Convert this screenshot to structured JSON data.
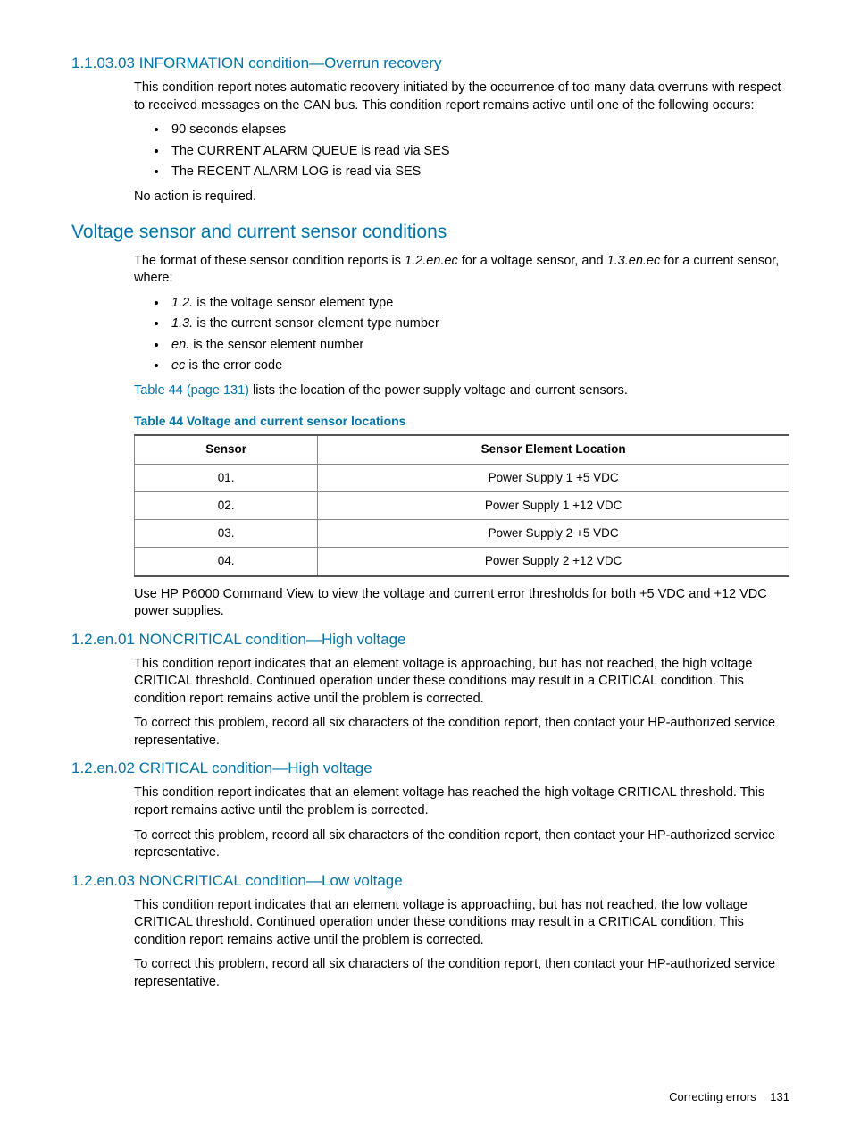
{
  "sec1": {
    "title": "1.1.03.03 INFORMATION condition—Overrun recovery",
    "p1": "This condition report notes automatic recovery initiated by the occurrence of too many data overruns with respect to received messages on the CAN bus. This condition report remains active until one of the following occurs:",
    "b1": "90 seconds elapses",
    "b2": "The CURRENT ALARM QUEUE is read via SES",
    "b3": "The RECENT ALARM LOG is read via SES",
    "p2": "No action is required."
  },
  "sec2": {
    "title": "Voltage sensor and current sensor conditions",
    "p1a": "The format of these sensor condition reports is ",
    "p1b": "1.2.en.ec",
    "p1c": " for a voltage sensor, and ",
    "p1d": "1.3.en.ec",
    "p1e": " for a current sensor, where:",
    "li1a": "1.2.",
    "li1b": " is the voltage sensor element type",
    "li2a": "1.3.",
    "li2b": " is the current sensor element type number",
    "li3a": "en.",
    "li3b": " is the sensor element number",
    "li4a": "ec",
    "li4b": " is the error code",
    "link": "Table 44 (page 131)",
    "linktail": " lists the location of the power supply voltage and current sensors.",
    "table_caption": "Table 44 Voltage and current sensor locations",
    "th1": "Sensor",
    "th2": "Sensor Element Location",
    "rows": [
      {
        "s": "01.",
        "loc": "Power Supply 1 +5 VDC"
      },
      {
        "s": "02.",
        "loc": "Power Supply 1 +12 VDC"
      },
      {
        "s": "03.",
        "loc": "Power Supply 2 +5 VDC"
      },
      {
        "s": "04.",
        "loc": "Power Supply 2 +12 VDC"
      }
    ],
    "p2": "Use HP P6000 Command View to view the voltage and current error thresholds for both +5 VDC and +12 VDC power supplies."
  },
  "sec3": {
    "title": "1.2.en.01 NONCRITICAL condition—High voltage",
    "p1": "This condition report indicates that an element voltage is approaching, but has not reached, the high voltage CRITICAL threshold. Continued operation under these conditions may result in a CRITICAL condition. This condition report remains active until the problem is corrected.",
    "p2": "To correct this problem, record all six characters of the condition report, then contact your HP-authorized service representative."
  },
  "sec4": {
    "title": "1.2.en.02 CRITICAL condition—High voltage",
    "p1": "This condition report indicates that an element voltage has reached the high voltage CRITICAL threshold. This report remains active until the problem is corrected.",
    "p2": "To correct this problem, record all six characters of the condition report, then contact your HP-authorized service representative."
  },
  "sec5": {
    "title": "1.2.en.03 NONCRITICAL condition—Low voltage",
    "p1": "This condition report indicates that an element voltage is approaching, but has not reached, the low voltage CRITICAL threshold. Continued operation under these conditions may result in a CRITICAL condition. This condition report remains active until the problem is corrected.",
    "p2": "To correct this problem, record all six characters of the condition report, then contact your HP-authorized service representative."
  },
  "footer": {
    "label": "Correcting errors",
    "page": "131"
  }
}
